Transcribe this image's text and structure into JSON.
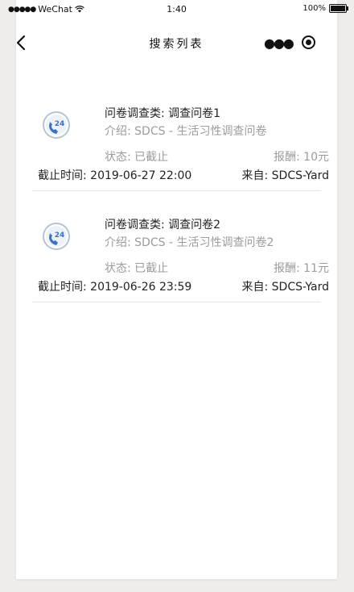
{
  "status_bar": {
    "carrier": "WeChat",
    "time": "1:40",
    "battery": "100%"
  },
  "nav": {
    "title": "搜索列表"
  },
  "surveys": [
    {
      "category_label": "问卷调查类:",
      "category_value": "调查问卷1",
      "intro_label": "介绍:",
      "intro_value": "SDCS - 生活习性调查问卷",
      "status_label": "状态:",
      "status_value": "已截止",
      "reward_label": "报酬:",
      "reward_value": "10元",
      "deadline_label": "截止时间:",
      "deadline_value": "2019-06-27 22:00",
      "from_label": "来自:",
      "from_value": "SDCS-Yard"
    },
    {
      "category_label": "问卷调查类:",
      "category_value": "调查问卷2",
      "intro_label": "介绍:",
      "intro_value": "SDCS - 生活习性调查问卷2",
      "status_label": "状态:",
      "status_value": "已截止",
      "reward_label": "报酬:",
      "reward_value": "11元",
      "deadline_label": "截止时间:",
      "deadline_value": "2019-06-26 23:59",
      "from_label": "来自:",
      "from_value": "SDCS-Yard"
    }
  ],
  "icons": {
    "card_icon": "phone-24h-icon",
    "icon_text": "24",
    "accent_color": "#3a72c4",
    "ring_color": "#b7c3d3"
  }
}
